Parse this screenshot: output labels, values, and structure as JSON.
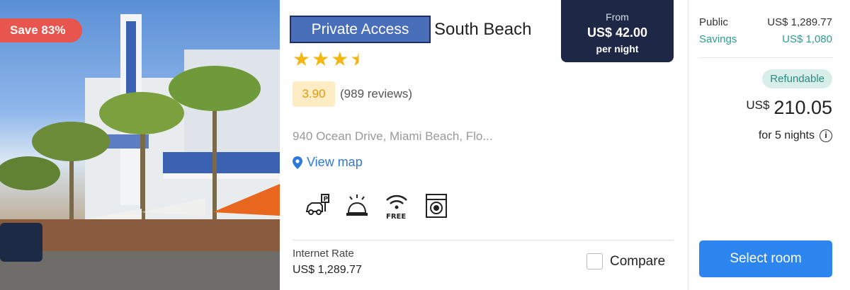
{
  "photo": {
    "save_badge": "Save 83%"
  },
  "hotel": {
    "private_access_label": "Private Access",
    "name": "South Beach",
    "stars": 3.5,
    "score": "3.90",
    "reviews": "(989 reviews)",
    "address": "940 Ocean Drive, Miami Beach, Flo...",
    "view_map": "View map",
    "amenities": [
      "parking-icon",
      "concierge-bell-icon",
      "free-wifi-icon",
      "laundry-icon"
    ],
    "wifi_free_text": "FREE",
    "internet_rate_label": "Internet Rate",
    "internet_rate_value": "US$ 1,289.77",
    "compare_label": "Compare"
  },
  "from_price": {
    "label": "From",
    "price": "US$ 42.00",
    "per_night": "per night"
  },
  "summary": {
    "public_label": "Public",
    "public_value": "US$ 1,289.77",
    "savings_label": "Savings",
    "savings_value": "US$ 1,080",
    "refundable": "Refundable",
    "currency": "US$",
    "total": "210.05",
    "nights": "for 5 nights",
    "select_room": "Select room"
  },
  "colors": {
    "save_badge": "#e8554e",
    "private_box": "#4a6fba",
    "from_box": "#1f2747",
    "savings": "#2a9d8f",
    "button": "#2d86f0",
    "star": "#f3b613"
  }
}
